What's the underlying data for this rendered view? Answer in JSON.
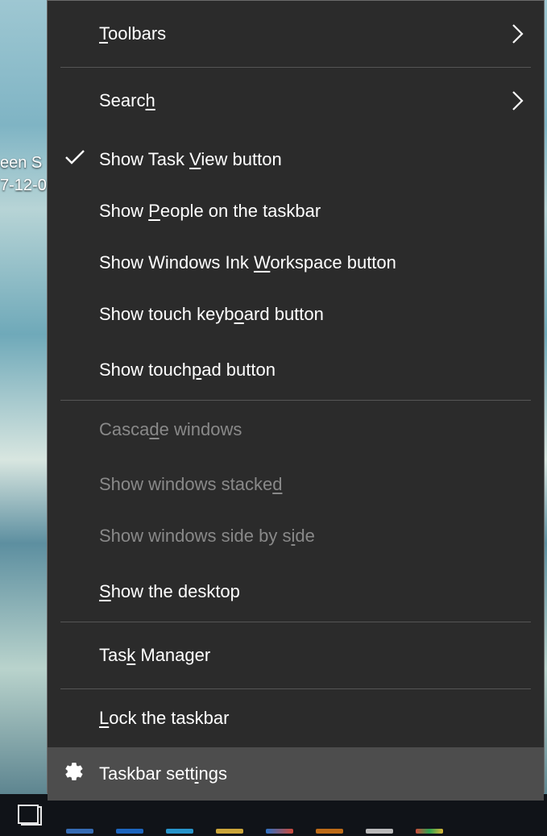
{
  "desktop": {
    "icon_label_line1": "een S",
    "icon_label_line2": "7-12-0"
  },
  "menu": {
    "toolbars": "Toolbars",
    "search": "Search",
    "show_task_view": "Show Task View button",
    "show_people": "Show People on the taskbar",
    "show_ink": "Show Windows Ink Workspace button",
    "show_touch_kb": "Show touch keyboard button",
    "show_touchpad": "Show touchpad button",
    "cascade": "Cascade windows",
    "stacked": "Show windows stacked",
    "side_by_side": "Show windows side by side",
    "show_desktop": "Show the desktop",
    "task_manager": "Task Manager",
    "lock_taskbar": "Lock the taskbar",
    "taskbar_settings": "Taskbar settings"
  },
  "underline": {
    "toolbars": 0,
    "search": 5,
    "show_task_view": 10,
    "show_people": 5,
    "show_ink": 17,
    "show_touch_kb": 15,
    "show_touchpad": 10,
    "cascade": 5,
    "stacked": 19,
    "side_by_side": 22,
    "show_desktop": 0,
    "task_manager": 3,
    "lock_taskbar": 0,
    "taskbar_settings": 12
  }
}
